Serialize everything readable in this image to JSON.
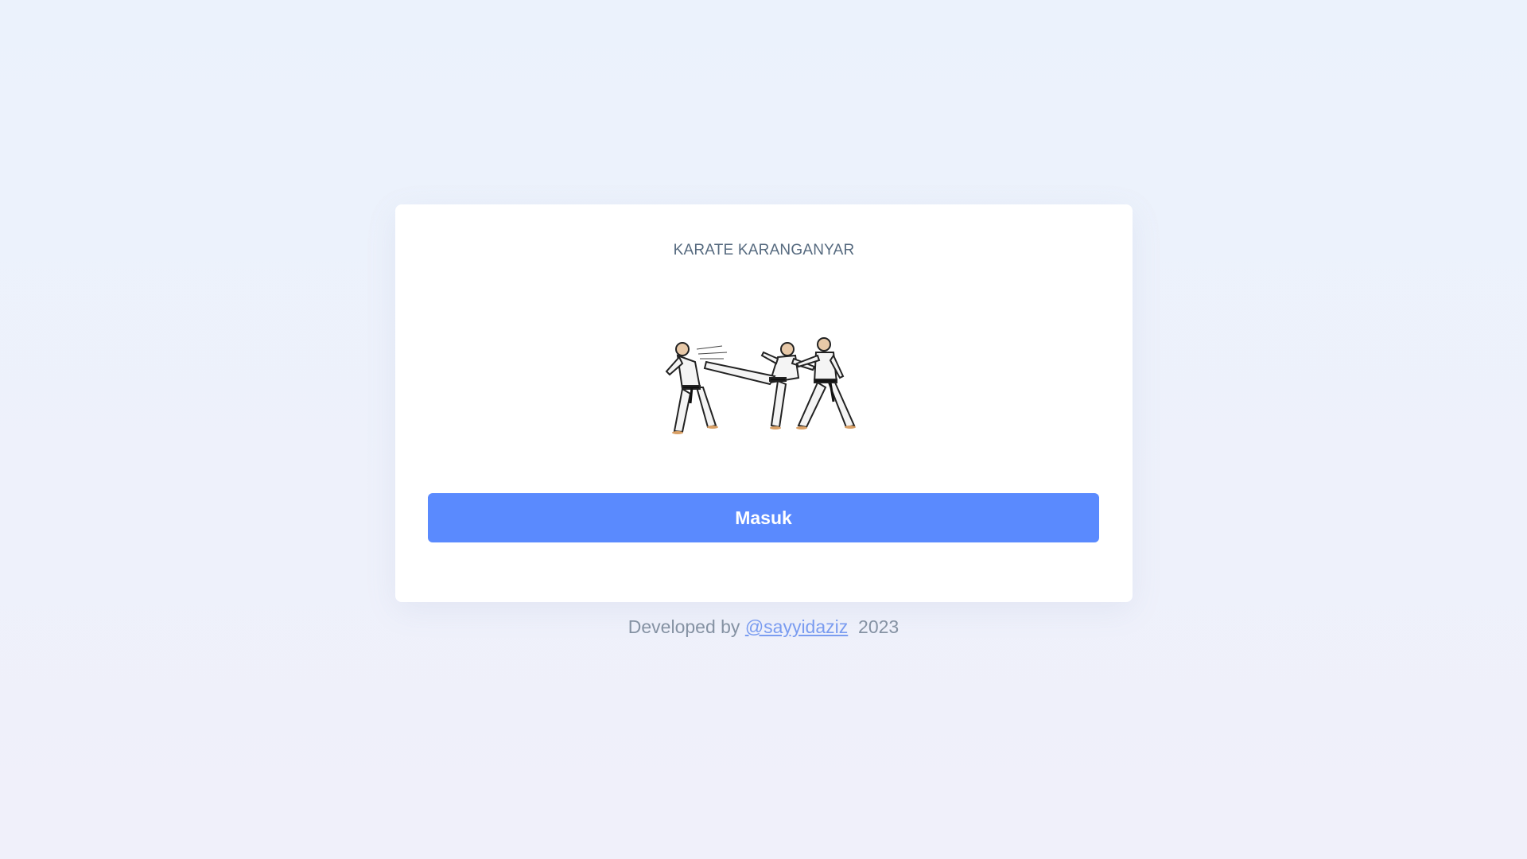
{
  "card": {
    "title": "KARATE KARANGANYAR",
    "logo_icon": "karate-fighters-logo",
    "login_label": "Masuk"
  },
  "footer": {
    "prefix": "Developed by",
    "author_link": "@sayyidaziz",
    "year": "2023"
  },
  "colors": {
    "background": "#ebf2fc",
    "card": "#ffffff",
    "button": "#5a8afe",
    "title_text": "#566a7f",
    "footer_text": "#8592a3",
    "link": "#7a9cf0"
  }
}
